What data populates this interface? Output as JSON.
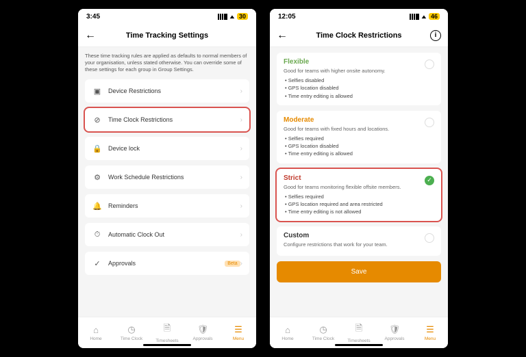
{
  "screen1": {
    "status": {
      "time": "3:45",
      "battery": "30"
    },
    "title": "Time Tracking Settings",
    "description": "These time tracking rules are applied as defaults to normal members of your organisation, unless stated otherwise. You can override some of these settings for each group in Group Settings.",
    "rows": [
      {
        "icon": "device-icon",
        "glyph": "▣",
        "label": "Device Restrictions"
      },
      {
        "icon": "clock-restrict-icon",
        "glyph": "⊘",
        "label": "Time Clock Restrictions",
        "highlight": true
      },
      {
        "icon": "lock-icon",
        "glyph": "🔒",
        "label": "Device lock"
      },
      {
        "icon": "schedule-icon",
        "glyph": "⚙",
        "label": "Work Schedule Restrictions"
      },
      {
        "icon": "bell-icon",
        "glyph": "🔔",
        "label": "Reminders"
      },
      {
        "icon": "auto-clock-icon",
        "glyph": "⏱",
        "label": "Automatic Clock Out"
      },
      {
        "icon": "approvals-icon",
        "glyph": "✓",
        "label": "Approvals",
        "badge": "Beta"
      }
    ]
  },
  "screen2": {
    "status": {
      "time": "12:05",
      "battery": "46"
    },
    "title": "Time Clock Restrictions",
    "options": [
      {
        "key": "flexible",
        "title": "Flexible",
        "sub": "Good for teams with higher onsite autonomy.",
        "bullets": [
          "Selfies disabled",
          "GPS location disabled",
          "Time entry editing is allowed"
        ]
      },
      {
        "key": "moderate",
        "title": "Moderate",
        "sub": "Good for teams with fixed hours and locations.",
        "bullets": [
          "Selfies required",
          "GPS location disabled",
          "Time entry editing is allowed"
        ]
      },
      {
        "key": "strict",
        "title": "Strict",
        "sub": "Good for teams monitoring flexible offsite members.",
        "bullets": [
          "Selfies required",
          "GPS location required and area restricted",
          "Time entry editing is not allowed"
        ],
        "selected": true,
        "highlight": true
      },
      {
        "key": "custom",
        "title": "Custom",
        "sub": "Configure restrictions that work for your team."
      }
    ],
    "save": "Save"
  },
  "tabs": [
    {
      "name": "home",
      "glyph": "⌂",
      "label": "Home"
    },
    {
      "name": "timeclock",
      "glyph": "◷",
      "label": "Time Clock"
    },
    {
      "name": "timesheets",
      "glyph": "🗎",
      "label": "Timesheets"
    },
    {
      "name": "approvals",
      "glyph": "🛡",
      "label": "Approvals"
    },
    {
      "name": "menu",
      "glyph": "☰",
      "label": "Menu",
      "active": true
    }
  ]
}
